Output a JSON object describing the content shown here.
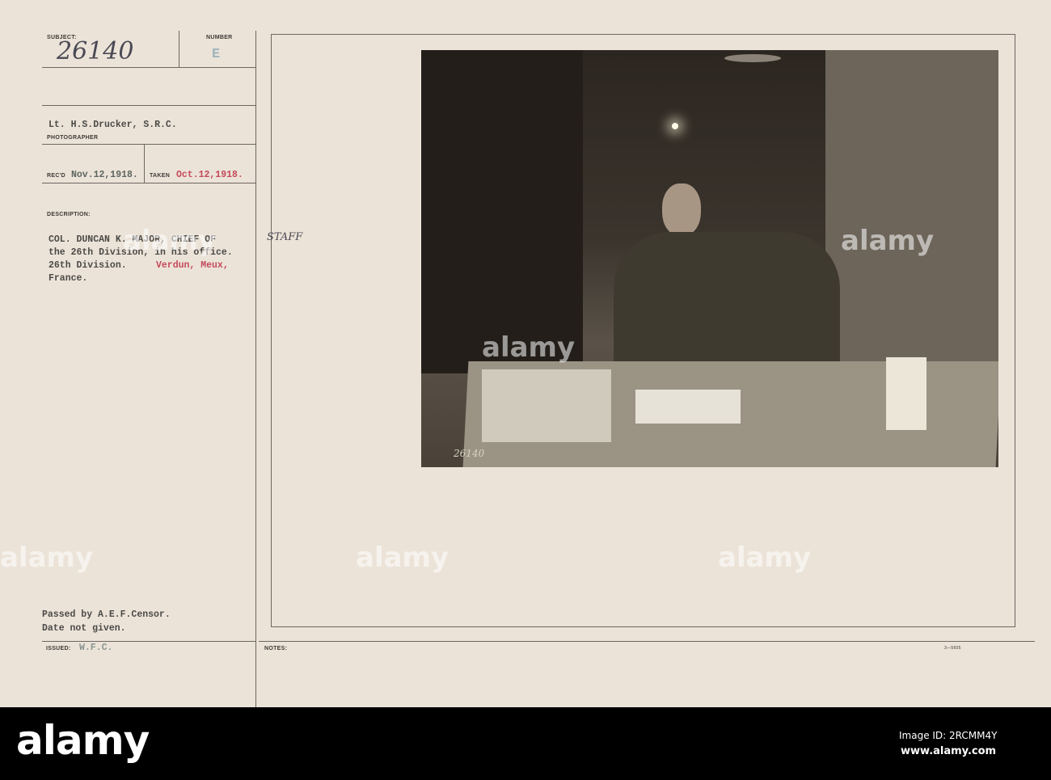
{
  "card": {
    "subject_label": "SUBJECT:",
    "subject_value": "26140",
    "number_label": "NUMBER",
    "number_value": "E",
    "photographer_value": "Lt. H.S.Drucker, S.R.C.",
    "photographer_label": "PHOTOGRAPHER",
    "recd_label": "REC'D",
    "recd_value": "Nov.12,1918.",
    "taken_label": "TAKEN",
    "taken_value": "Oct.12,1918.",
    "description_label": "DESCRIPTION:",
    "description_lines": [
      "COL. DUNCAN K. MAJOR, CHIEF OF",
      "the 26th Division, in his office.",
      "26th Division.",
      "France."
    ],
    "description_hand": "STAFF",
    "description_place": "Verdun, Meux,",
    "censor_lines": [
      "Passed by A.E.F.Censor.",
      "Date not given."
    ],
    "issued_label": "ISSUED:",
    "issued_value": "W.F.C.",
    "notes_label": "NOTES:",
    "form_number": "3—5605",
    "photo_number": "26140"
  },
  "watermark": "alamy",
  "footer": {
    "logo": "alamy",
    "image_id": "Image ID: 2RCMM4Y",
    "url": "www.alamy.com"
  }
}
